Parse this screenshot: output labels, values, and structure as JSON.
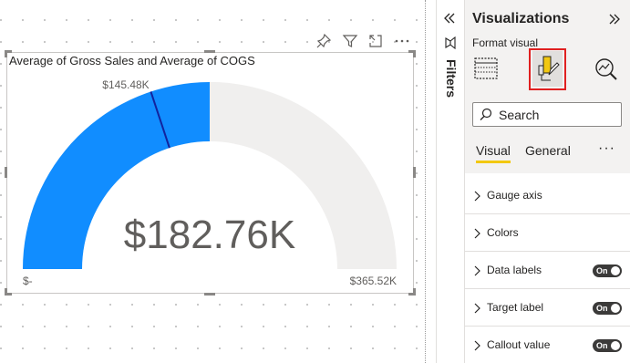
{
  "visual": {
    "title": "Average of Gross Sales and Average of COGS",
    "header_icons": [
      "pin-icon",
      "filter-icon",
      "focus-mode-icon",
      "more-options-icon"
    ],
    "gauge": {
      "value_label": "$182.76K",
      "min_label": "$-",
      "max_label": "$365.52K",
      "target_label": "$145.48K",
      "value": 182.76,
      "min": 0,
      "max": 365.52,
      "target": 145.48,
      "fill_color": "#118dff",
      "track_color": "#f0efee",
      "target_color": "#12239e"
    }
  },
  "filters": {
    "label": "Filters"
  },
  "visualizations": {
    "title": "Visualizations",
    "format_label": "Format visual",
    "tabs": [
      "build-visual-icon",
      "format-visual-icon",
      "analytics-icon"
    ],
    "active_tab": "format-visual-icon",
    "search_placeholder": "Search",
    "subtabs": [
      "Visual",
      "General"
    ],
    "active_subtab": "Visual",
    "sections": [
      {
        "label": "Gauge axis",
        "toggle": null
      },
      {
        "label": "Colors",
        "toggle": null
      },
      {
        "label": "Data labels",
        "toggle": "On"
      },
      {
        "label": "Target label",
        "toggle": "On"
      },
      {
        "label": "Callout value",
        "toggle": "On"
      }
    ],
    "accent_color": "#f2c811",
    "highlight_color": "#e02020"
  }
}
